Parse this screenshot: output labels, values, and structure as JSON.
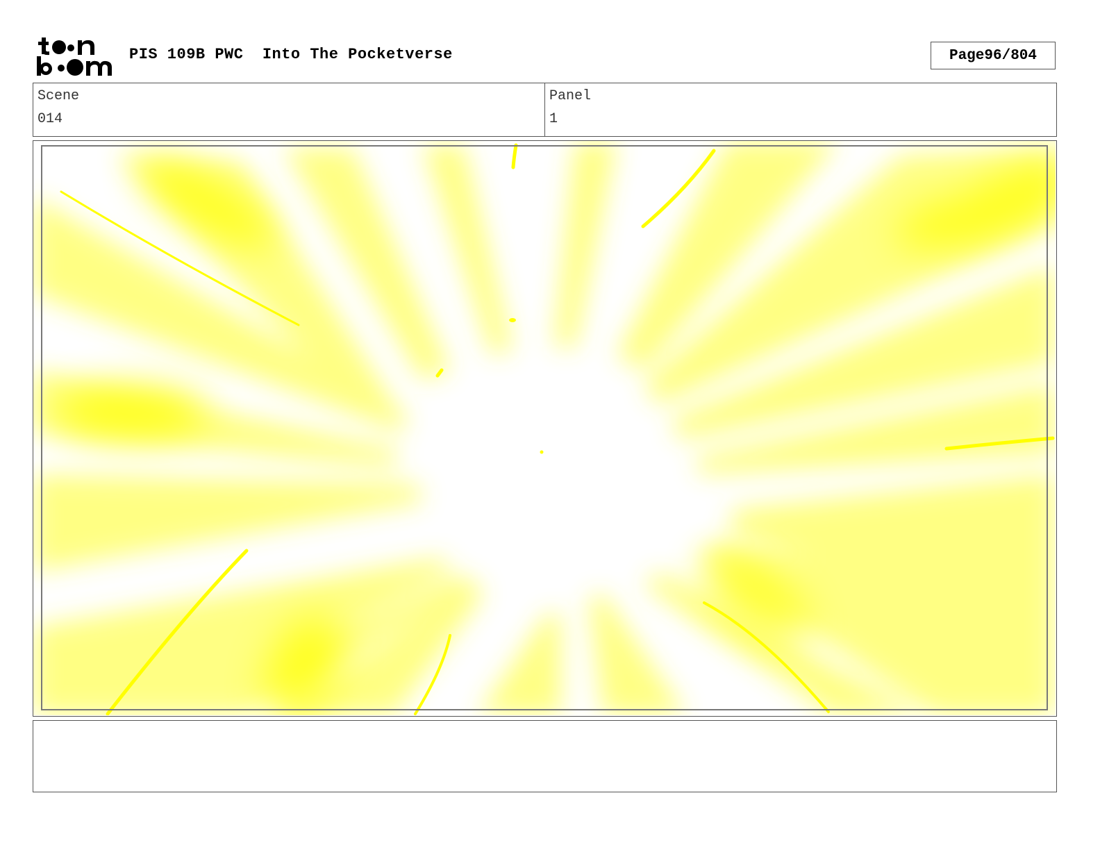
{
  "header": {
    "logo_text": "toon boom",
    "title": "PIS 109B PWC  Into The Pocketverse",
    "page_label": "Page",
    "page_number": "96/804"
  },
  "info": {
    "scene_label": "Scene",
    "scene_value": "014",
    "panel_label": "Panel",
    "panel_value": "1"
  },
  "artwork": {
    "description_color": "#ffff00"
  },
  "caption": {
    "text": ""
  },
  "colors": {
    "accent_yellow": "#ffff00",
    "border": "#555555"
  }
}
